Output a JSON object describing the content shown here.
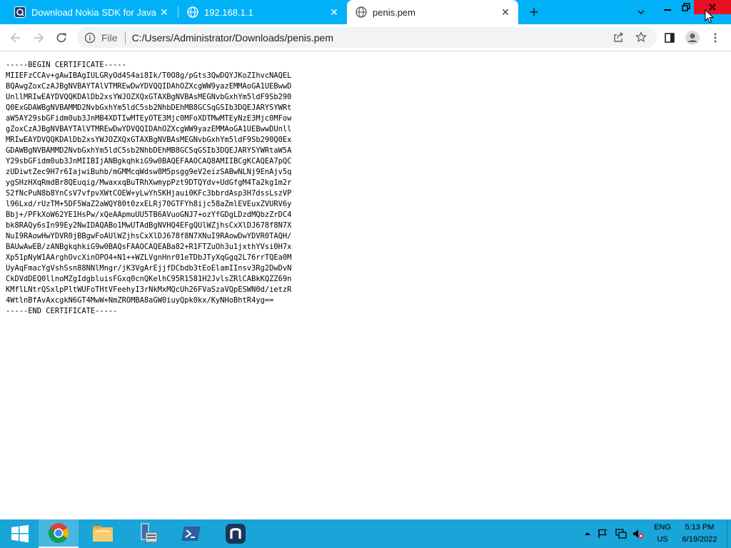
{
  "browser": {
    "tabs": [
      {
        "title": "Download Nokia SDK for Java by",
        "favicon": "nokia-square-icon",
        "active": false
      },
      {
        "title": "192.168.1.1",
        "favicon": "globe-icon",
        "active": false
      },
      {
        "title": "penis.pem",
        "favicon": "globe-icon",
        "active": true
      }
    ],
    "new_tab_label": "+",
    "window_controls": [
      "minimize-icon",
      "restore-icon",
      "close-icon"
    ]
  },
  "toolbar": {
    "scheme_label": "File",
    "url": "C:/Users/Administrator/Downloads/penis.pem",
    "icons": [
      "back-icon",
      "forward-icon",
      "reload-icon",
      "info-icon",
      "share-icon",
      "star-icon",
      "side-panel-icon",
      "profile-icon",
      "menu-icon"
    ]
  },
  "content": {
    "certificate_lines": [
      "-----BEGIN CERTIFICATE-----",
      "MIIEFzCCAv+gAwIBAgIULGRyOd4S4ai8Ik/T0O8g/pGts3QwDQYJKoZIhvcNAQEL",
      "BQAwgZoxCzAJBgNVBAYTAlVTMREwDwYDVQQIDAhOZXcgWW9yazEMMAoGA1UEBwwD",
      "UnllMRIwEAYDVQQKDAlDb2xsYWJOZXQxGTAXBgNVBAsMEGNvbGxhYm5ldF9Sb290",
      "Q0ExGDAWBgNVBAMMD2NvbGxhYm5ldC5sb2NhbDEhMB8GCSqGSIb3DQEJARYSYWRt",
      "aW5AY29sbGFidm0ub3JnMB4XDTIwMTEyOTE3Mjc0MFoXDTMwMTEyNzE3Mjc0MFow",
      "gZoxCzAJBgNVBAYTAlVTMREwDwYDVQQIDAhOZXcgWW9yazEMMAoGA1UEBwwDUnll",
      "MRIwEAYDVQQKDAlDb2xsYWJOZXQxGTAXBgNVBAsMEGNvbGxhYm5ldF9Sb290Q0Ex",
      "GDAWBgNVBAMMD2NvbGxhYm5ldC5sb2NhbDEhMB8GCSqGSIb3DQEJARYSYWRtaW5A",
      "Y29sbGFidm0ub3JnMIIBIjANBgkqhkiG9w0BAQEFAAOCAQ8AMIIBCgKCAQEA7pQC",
      "zUDiwtZec9H7r6IajwiBuhb/mGMMcqWdsw8M5psgg9eV2eizSABwNLNj9EnAjv5q",
      "ygSHzHXqRmdBr8QEuqig/MwaxxqBuTRhXwmypPzt9DTQYdv+UdGfgM4Ta2kg1m2r",
      "S2fNcPuN8b8YnCsV7vfpvXWtCOEW+yLwYhSKHjaui0KFc3bbrdAsp3H7dssLszVP",
      "l96Lxd/rUzTM+5DF5WaZ2aWQY80t0zxELRj70GTFYh8ijc58aZmlEVEuxZVURV6y",
      "Bbj+/PFkXoW62YE1HsPw/xQeAApmuUU5TB6AVuoGNJ7+ozYfGDgLDzdMQbzZrDC4",
      "bk8RAQy6sIn99Ey2NwIDAQABo1MwUTAdBgNVHQ4EFgQUlWZjhsCxXlDJ678f8N7X",
      "NuI9RAowHwYDVR0jBBgwFoAUlWZjhsCxXlDJ678f8N7XNuI9RAowDwYDVR0TAQH/",
      "BAUwAwEB/zANBgkqhkiG9w0BAQsFAAOCAQEABa82+R1FTZuOh3u1jxthYVsi0H7x",
      "Xp51pNyW1AArghOvcXinOPO4+N1++WZLVgnHnr01eTDbJTyXqGgq2L76rrTQEa0M",
      "UyAqFmacYgVshSsn88NNlMngr/jK3VgArEjjfDCbdb3tEoElamIInsv3Rg2DwDvN",
      "CkDVdDEQ0llnoMZgIdgbluisFGxq0cnQKelhC95R1581H2JvlsZRlCABkKQZZ69n",
      "KMflLNtrQSxlpPltWUFoTHtVFeehyI3rNkMxMQcUh26FVaSzaVQpESWN0d/ietzR",
      "4WtlnBfAvAxcgkN6GT4MwW+NmZROMBA8aGW0iuyQpk0kx/KyNHoBhtR4yg==",
      "-----END CERTIFICATE-----"
    ]
  },
  "taskbar": {
    "items": [
      "windows-start-icon",
      "chrome-icon",
      "file-explorer-icon",
      "server-manager-icon",
      "powershell-icon",
      "nessus-icon"
    ],
    "tray": {
      "language": "ENG",
      "region": "US",
      "time": "5:13 PM",
      "date": "6/19/2022"
    }
  },
  "colors": {
    "tabstrip": "#00b1f7",
    "taskbar": "#1aa5d8",
    "close_button": "#e81123"
  }
}
